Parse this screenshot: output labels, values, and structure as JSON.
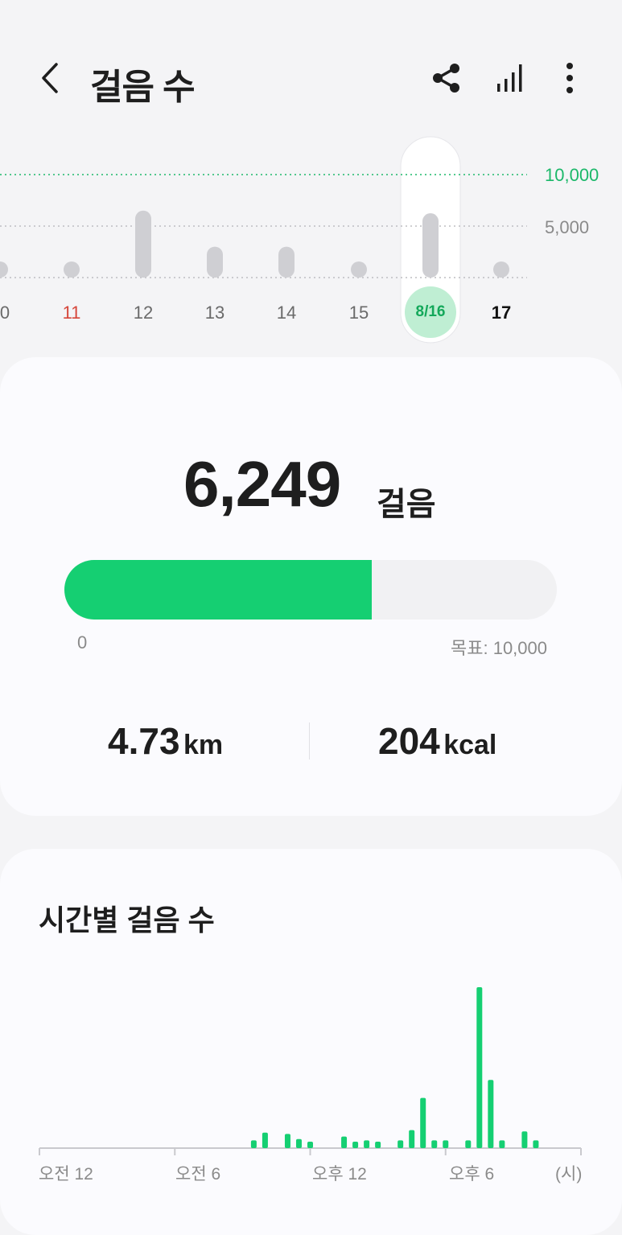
{
  "header": {
    "title": "걸음 수",
    "icons": [
      "back-arrow-icon",
      "share-icon",
      "bar-chart-icon",
      "more-vertical-icon"
    ]
  },
  "weekly": {
    "goal_label": "10,000",
    "mid_label": "5,000",
    "days": [
      {
        "label": "0",
        "type": "normal"
      },
      {
        "label": "11",
        "type": "holiday"
      },
      {
        "label": "12",
        "type": "normal"
      },
      {
        "label": "13",
        "type": "normal"
      },
      {
        "label": "14",
        "type": "normal"
      },
      {
        "label": "15",
        "type": "normal"
      },
      {
        "label": "8/16",
        "type": "selected"
      },
      {
        "label": "17",
        "type": "today"
      }
    ],
    "steps": [
      0,
      0,
      6500,
      3000,
      3000,
      0,
      6249,
      0
    ],
    "colors": {
      "goal_line": "#1cb86a",
      "bar": "#cfcfd3",
      "selected_badge": "#bfeed3",
      "holiday": "#d6463a"
    }
  },
  "summary": {
    "steps": "6,249",
    "steps_unit": "걸음",
    "progress_fraction": 0.6249,
    "progress_min": "0",
    "progress_goal": "목표: 10,000",
    "distance_value": "4.73",
    "distance_unit": "km",
    "calories_value": "204",
    "calories_unit": "kcal"
  },
  "hourly": {
    "title": "시간별 걸음 수",
    "axis_labels": [
      "오전 12",
      "오전 6",
      "오후 12",
      "오후 6",
      "(시)"
    ],
    "chart_data": {
      "type": "bar",
      "xlabel": "",
      "ylabel": "",
      "x_unit": "(시)",
      "values": [
        {
          "hour": 9.5,
          "steps": 60
        },
        {
          "hour": 10.0,
          "steps": 120
        },
        {
          "hour": 11.0,
          "steps": 110
        },
        {
          "hour": 11.5,
          "steps": 70
        },
        {
          "hour": 12.0,
          "steps": 50
        },
        {
          "hour": 13.5,
          "steps": 90
        },
        {
          "hour": 14.0,
          "steps": 50
        },
        {
          "hour": 14.5,
          "steps": 60
        },
        {
          "hour": 15.0,
          "steps": 50
        },
        {
          "hour": 16.0,
          "steps": 60
        },
        {
          "hour": 16.5,
          "steps": 140
        },
        {
          "hour": 17.0,
          "steps": 390
        },
        {
          "hour": 17.5,
          "steps": 60
        },
        {
          "hour": 18.0,
          "steps": 60
        },
        {
          "hour": 19.0,
          "steps": 60
        },
        {
          "hour": 19.5,
          "steps": 1250
        },
        {
          "hour": 20.0,
          "steps": 530
        },
        {
          "hour": 20.5,
          "steps": 60
        },
        {
          "hour": 21.5,
          "steps": 130
        },
        {
          "hour": 22.0,
          "steps": 60
        }
      ],
      "bar_color": "#15cf72"
    }
  }
}
